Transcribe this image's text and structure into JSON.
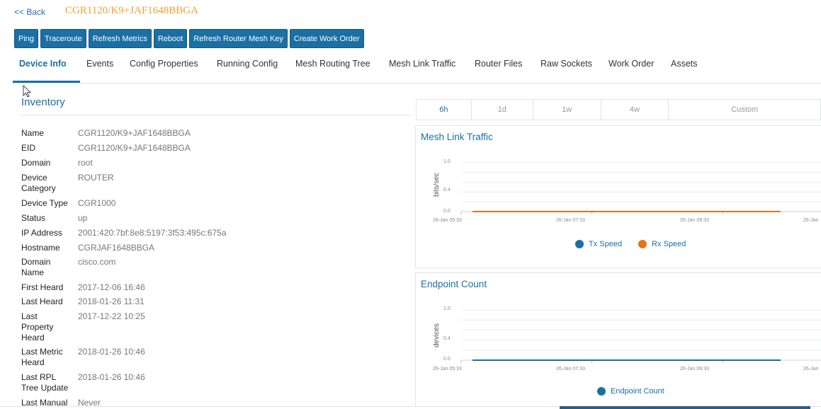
{
  "header": {
    "back_label": "<< Back",
    "device_title": "CGR1120/K9+JAF1648BBGA"
  },
  "actions": [
    {
      "label": "Ping"
    },
    {
      "label": "Traceroute"
    },
    {
      "label": "Refresh Metrics"
    },
    {
      "label": "Reboot"
    },
    {
      "label": "Refresh Router Mesh Key"
    },
    {
      "label": "Create Work Order"
    }
  ],
  "tabs": [
    {
      "label": "Device Info",
      "active": true
    },
    {
      "label": "Events"
    },
    {
      "label": "Config Properties"
    },
    {
      "label": "Running Config"
    },
    {
      "label": "Mesh Routing Tree"
    },
    {
      "label": "Mesh Link Traffic"
    },
    {
      "label": "Router Files"
    },
    {
      "label": "Raw Sockets"
    },
    {
      "label": "Work Order"
    },
    {
      "label": "Assets"
    }
  ],
  "inventory": {
    "heading": "Inventory",
    "rows": [
      {
        "label": "Name",
        "value": "CGR1120/K9+JAF1648BBGA"
      },
      {
        "label": "EID",
        "value": "CGR1120/K9+JAF1648BBGA"
      },
      {
        "label": "Domain",
        "value": "root"
      },
      {
        "label": "Device Category",
        "value": "ROUTER"
      },
      {
        "label": "Device Type",
        "value": "CGR1000"
      },
      {
        "label": "Status",
        "value": "up"
      },
      {
        "label": "IP Address",
        "value": "2001:420:7bf:8e8:5197:3f53:495c:675a"
      },
      {
        "label": "Hostname",
        "value": "CGRJAF1648BBGA"
      },
      {
        "label": "Domain Name",
        "value": "cisco.com"
      },
      {
        "label": "First Heard",
        "value": "2017-12-06 16:46"
      },
      {
        "label": "Last Heard",
        "value": "2018-01-26 11:31"
      },
      {
        "label": "Last Property Heard",
        "value": "2017-12-22 10:25"
      },
      {
        "label": "Last Metric Heard",
        "value": "2018-01-26 10:46"
      },
      {
        "label": "Last RPL Tree Update",
        "value": "2018-01-26 10:46"
      },
      {
        "label": "Last Manual",
        "value": "Never"
      }
    ]
  },
  "range_tabs": [
    {
      "label": "6h",
      "active": true
    },
    {
      "label": "1d"
    },
    {
      "label": "1w"
    },
    {
      "label": "4w"
    },
    {
      "label": "Custom"
    }
  ],
  "chart_data": [
    {
      "type": "line",
      "title": "Mesh Link Traffic",
      "ylabel": "bits/sec",
      "ylim": [
        0,
        1.0
      ],
      "y_ticks": [
        "1.0",
        "0.4",
        "0.0"
      ],
      "categories": [
        "26-Jan 05:33",
        "26-Jan 07:33",
        "26-Jan 09:33",
        "26-Jan"
      ],
      "series": [
        {
          "name": "Tx Speed",
          "color": "#1b6fa3",
          "values": [
            0,
            0,
            0,
            0
          ]
        },
        {
          "name": "Rx Speed",
          "color": "#e8701a",
          "values": [
            0,
            0,
            0,
            0
          ]
        }
      ],
      "legend_position": "bottom",
      "grid": true
    },
    {
      "type": "line",
      "title": "Endpoint Count",
      "ylabel": "devices",
      "ylim": [
        0,
        1.0
      ],
      "y_ticks": [
        "1.0",
        "0.4",
        "0.0"
      ],
      "categories": [
        "26-Jan 05:33",
        "26-Jan 07:33",
        "26-Jan 09:33",
        "26-Jan"
      ],
      "series": [
        {
          "name": "Endpoint Count",
          "color": "#1b6fa3",
          "values": [
            0,
            0,
            0,
            0
          ]
        }
      ],
      "legend_position": "bottom",
      "grid": true
    }
  ]
}
